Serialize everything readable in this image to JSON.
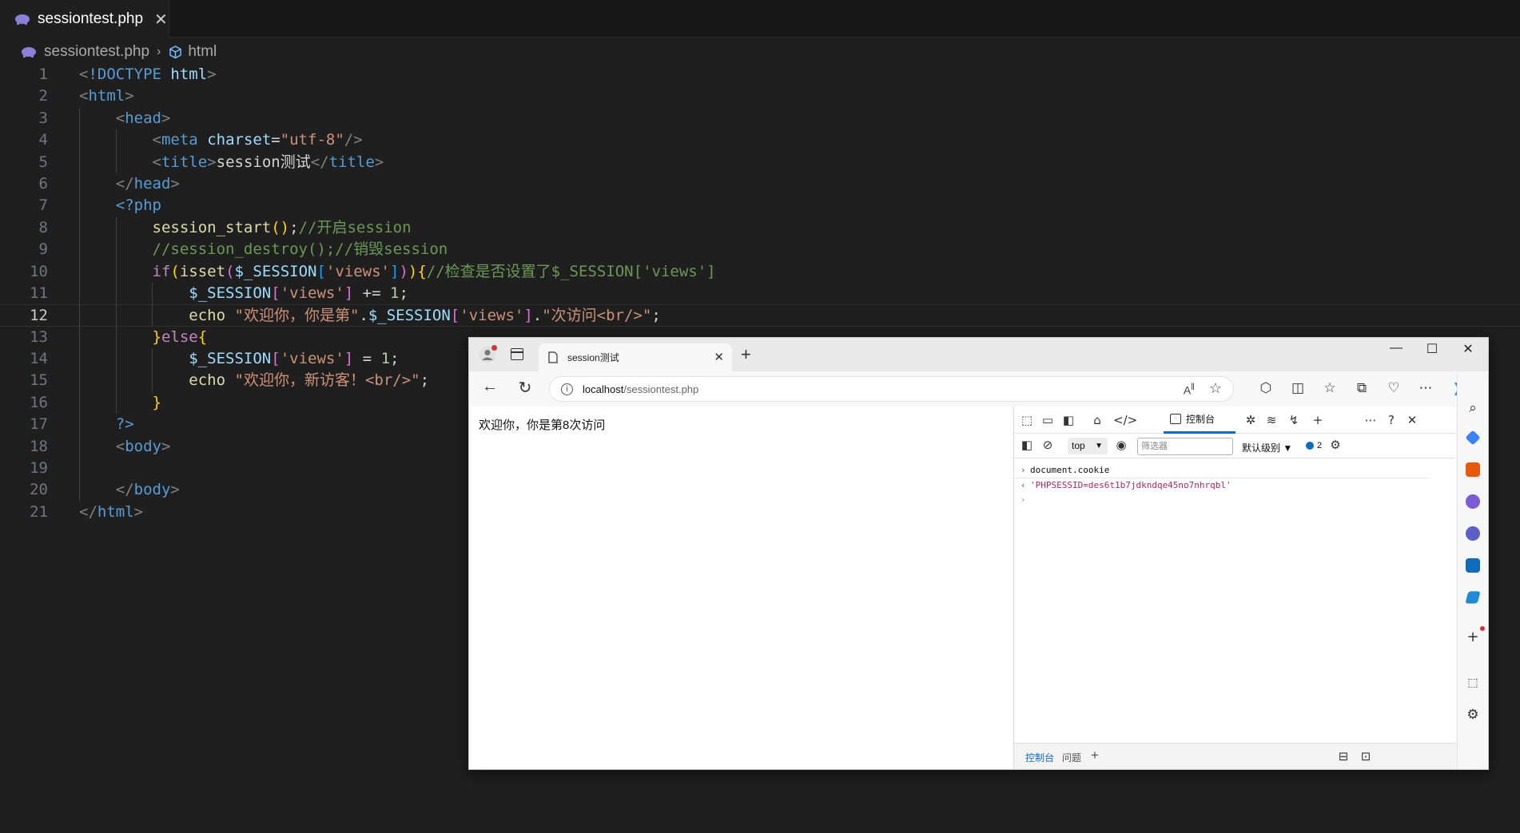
{
  "editor": {
    "tab": {
      "label": "sessiontest.php",
      "close": "✕"
    },
    "breadcrumb": {
      "file": "sessiontest.php",
      "symbol": "html"
    }
  },
  "browser": {
    "tab_title": "session测试",
    "address": {
      "host": "localhost",
      "path": "/sessiontest.php"
    },
    "page_text": "欢迎你，你是第8次访问",
    "devtools": {
      "console_tab": "控制台",
      "context": "top",
      "filter_placeholder": "筛选器",
      "level": "默认级别",
      "issues_count": "2",
      "command": "document.cookie",
      "result": "'PHPSESSID=des6t1b7jdkndqe45no7nhrqbl'",
      "drawer_tabs": [
        "控制台",
        "问题"
      ]
    }
  }
}
